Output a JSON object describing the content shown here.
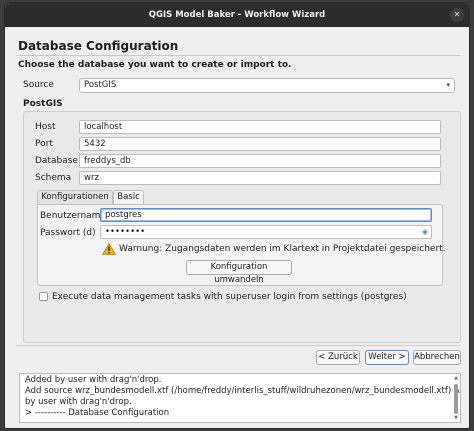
{
  "window": {
    "title": "QGIS Model Baker - Workflow Wizard",
    "close_glyph": "✕"
  },
  "page": {
    "title": "Database Configuration",
    "subtitle": "Choose the database you want to create or import to."
  },
  "source": {
    "label": "Source",
    "value": "PostGIS"
  },
  "group": {
    "title": "PostGIS"
  },
  "fields": {
    "host": {
      "label": "Host",
      "value": "localhost"
    },
    "port": {
      "label": "Port",
      "value": "5432"
    },
    "database": {
      "label": "Database",
      "value": "freddys_db"
    },
    "schema": {
      "label": "Schema",
      "value": "wrz"
    }
  },
  "tabs": [
    {
      "label": "Konfigurationen",
      "active": false
    },
    {
      "label": "Basic",
      "active": true
    }
  ],
  "auth": {
    "username_label": "Benutzername",
    "username_value": "postgres",
    "password_label": "Passwort (d)",
    "password_value": "••••••••",
    "warning": "Warnung: Zugangsdaten werden im Klartext in Projektdatei gespeichert.",
    "convert_button": "Konfiguration umwandeln"
  },
  "superuser_checkbox": {
    "label": "Execute data management tasks with superuser login from settings (postgres)",
    "checked": false
  },
  "nav": {
    "back": "< Zurück",
    "next": "Weiter >",
    "cancel": "Abbrechen"
  },
  "log": [
    "Added by user with drag'n'drop.",
    "Add source wrz_bundesmodell.xtf (/home/freddy/interlis_stuff/wildruhezonen/wrz_bundesmodell.xtf) Added",
    "by user with drag'n'drop.",
    "> ---------- Database Configuration"
  ],
  "icons": {
    "warning": "warning-triangle-icon",
    "combo_arrow": "▾",
    "eye": "◉"
  },
  "colors": {
    "focus": "#5a8bd6",
    "warning": "#f0b400"
  }
}
